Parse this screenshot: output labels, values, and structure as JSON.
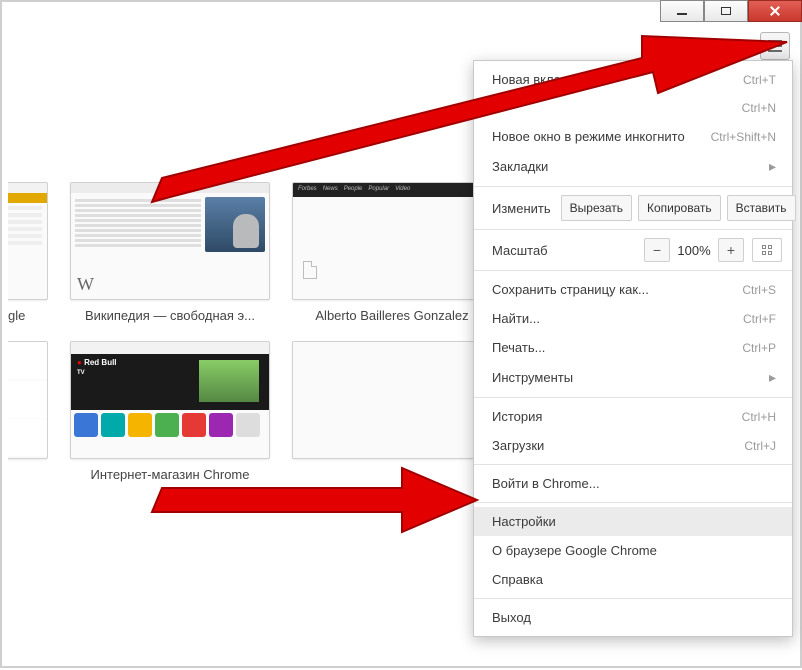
{
  "titlebar": {
    "min": "minimize",
    "max": "maximize",
    "close": "close"
  },
  "menu": {
    "new_tab": "Новая вкладка",
    "new_tab_sc": "Ctrl+T",
    "new_window_sc": "Ctrl+N",
    "incognito": "Новое окно в режиме инкогнито",
    "incognito_sc": "Ctrl+Shift+N",
    "bookmarks": "Закладки",
    "edit_label": "Изменить",
    "cut": "Вырезать",
    "copy": "Копировать",
    "paste": "Вставить",
    "zoom_label": "Масштаб",
    "zoom_value": "100%",
    "save_as": "Сохранить страницу как...",
    "save_as_sc": "Ctrl+S",
    "find": "Найти...",
    "find_sc": "Ctrl+F",
    "print": "Печать...",
    "print_sc": "Ctrl+P",
    "tools": "Инструменты",
    "history": "История",
    "history_sc": "Ctrl+H",
    "downloads": "Загрузки",
    "downloads_sc": "Ctrl+J",
    "signin": "Войти в Chrome...",
    "settings": "Настройки",
    "about": "О браузере Google Chrome",
    "help": "Справка",
    "exit": "Выход"
  },
  "tiles": {
    "google_lbl": "gle",
    "wiki_lbl": "Википедия — свободная э...",
    "forbes_lbl": "Alberto Bailleres Gonzalez",
    "col_lbl": "",
    "store_lbl": "Интернет-магазин Chrome",
    "forbes_hdr": "Forbes",
    "wiki_w": "W",
    "store_rb": "Red Bull",
    "store_tv": "TV"
  }
}
